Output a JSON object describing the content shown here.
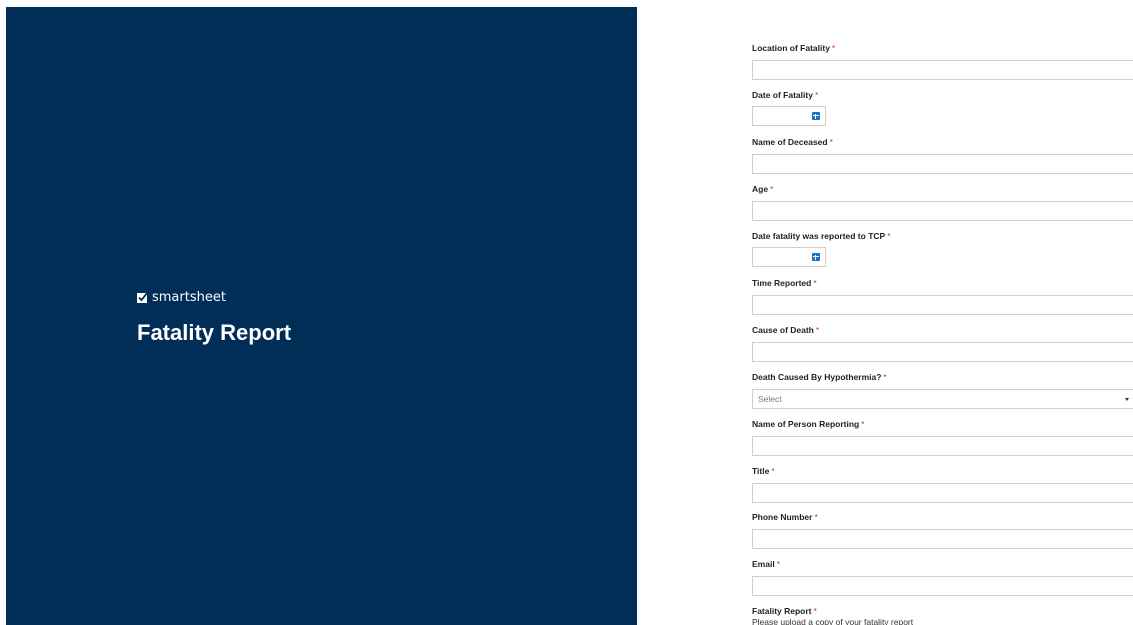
{
  "brand": {
    "name": "smartsheet",
    "icon": "smartsheet-logo-icon"
  },
  "form": {
    "title": "Fatality Report",
    "required_marker": "*",
    "fields": {
      "location": {
        "label": "Location of Fatality",
        "value": ""
      },
      "date": {
        "label": "Date of Fatality",
        "value": "",
        "icon": "calendar-icon"
      },
      "name_deceased": {
        "label": "Name of Deceased",
        "value": ""
      },
      "age": {
        "label": "Age",
        "value": ""
      },
      "date_reported": {
        "label": "Date fatality was reported to TCP",
        "value": "",
        "icon": "calendar-icon"
      },
      "time_reported": {
        "label": "Time Reported",
        "value": ""
      },
      "cause": {
        "label": "Cause of Death",
        "value": ""
      },
      "hypothermia": {
        "label": "Death Caused By Hypothermia?",
        "selected": "Select",
        "icon": "caret-down-icon"
      },
      "name_reporting": {
        "label": "Name of Person Reporting",
        "value": ""
      },
      "title": {
        "label": "Title",
        "value": ""
      },
      "phone": {
        "label": "Phone Number",
        "value": ""
      },
      "email": {
        "label": "Email",
        "value": ""
      },
      "fatality_report": {
        "label": "Fatality Report",
        "description": "Please upload a copy of your fatality report"
      }
    }
  },
  "colors": {
    "panel_background": "#002e56",
    "required": "#d0312d",
    "calendar_icon": "#1a73c8"
  }
}
